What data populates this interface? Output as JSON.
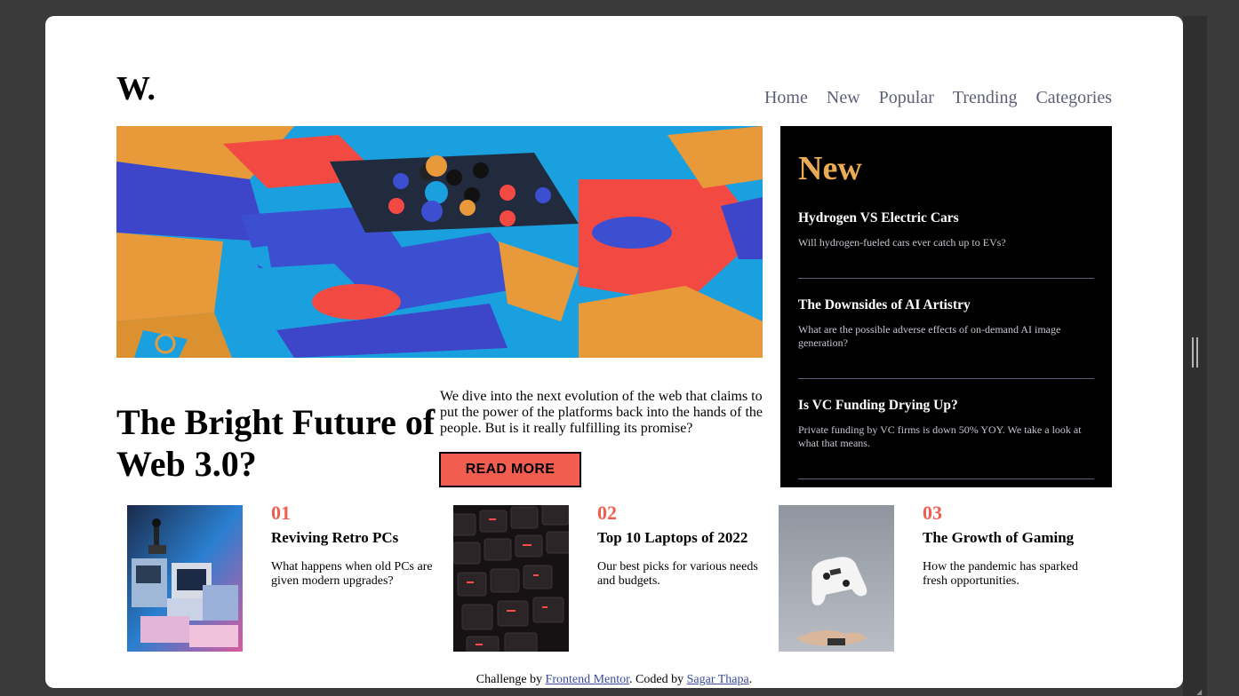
{
  "header": {
    "logo": "W.",
    "nav": [
      "Home",
      "New",
      "Popular",
      "Trending",
      "Categories"
    ]
  },
  "hero": {
    "image_icon": "abstract-3d-shapes-image",
    "title": "The Bright Future of Web 3.0?",
    "description": "We dive into the next evolution of the web that claims to put the power of the platforms back into the hands of the people. But is it really fulfilling its promise?",
    "button_label": "READ MORE"
  },
  "new_panel": {
    "heading": "New",
    "items": [
      {
        "title": "Hydrogen VS Electric Cars",
        "description": "Will hydrogen-fueled cars ever catch up to EVs?"
      },
      {
        "title": "The Downsides of AI Artistry",
        "description": "What are the possible adverse effects of on-demand AI image generation?"
      },
      {
        "title": "Is VC Funding Drying Up?",
        "description": "Private funding by VC firms is down 50% YOY. We take a look at what that means."
      }
    ]
  },
  "cards": [
    {
      "num": "01",
      "title": "Reviving Retro PCs",
      "description": "What happens when old PCs are given modern upgrades?",
      "image_icon": "retro-pc-image"
    },
    {
      "num": "02",
      "title": "Top 10 Laptops of 2022",
      "description": "Our best picks for various needs and budgets.",
      "image_icon": "laptop-keyboard-image"
    },
    {
      "num": "03",
      "title": "The Growth of Gaming",
      "description": "How the pandemic has sparked fresh opportunities.",
      "image_icon": "game-controller-image"
    }
  ],
  "footer": {
    "prefix": "Challenge by ",
    "link1": "Frontend Mentor",
    "middle": ". Coded by ",
    "link2": "Sagar Thapa",
    "suffix": "."
  },
  "colors": {
    "accent_orange": "#e9ab53",
    "accent_red": "#f15e50",
    "nav_text": "#5d5f79",
    "panel_bg": "#000000"
  }
}
